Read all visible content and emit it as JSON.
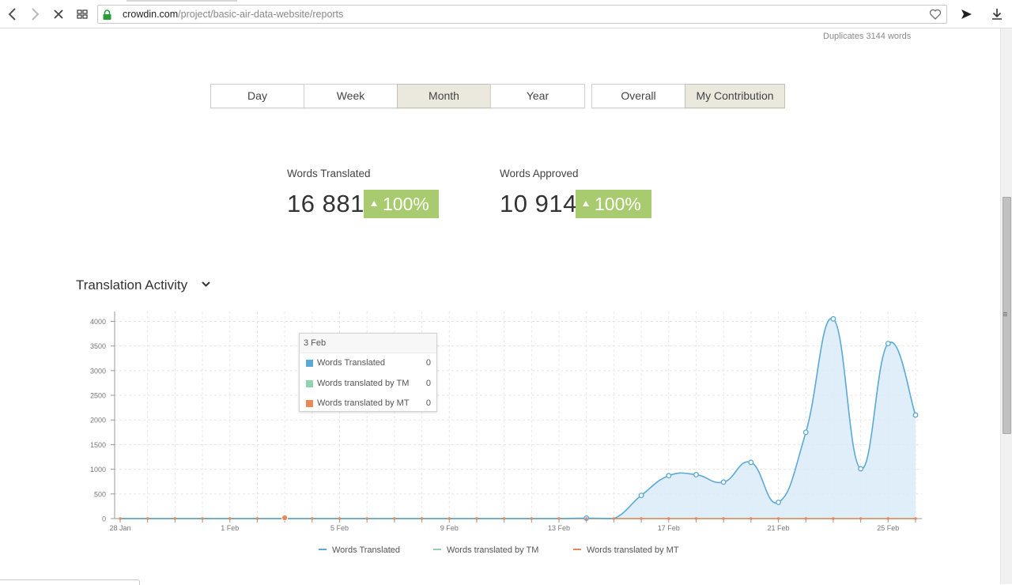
{
  "browser": {
    "url_host": "crowdin.com",
    "url_path": "/project/basic-air-data-website/reports",
    "icons": [
      "back-icon",
      "forward-icon",
      "stop-icon",
      "tabs-grid-icon",
      "lock-icon",
      "heart-icon",
      "send-icon",
      "download-icon"
    ]
  },
  "header": {
    "duplicates": "Duplicates 3144 words"
  },
  "period_buttons": [
    {
      "label": "Day",
      "active": false
    },
    {
      "label": "Week",
      "active": false
    },
    {
      "label": "Month",
      "active": true
    },
    {
      "label": "Year",
      "active": false
    }
  ],
  "scope_buttons": [
    {
      "label": "Overall",
      "active": false
    },
    {
      "label": "My Contribution",
      "active": true
    }
  ],
  "stats": {
    "translated": {
      "label": "Words Translated",
      "value": "16 881",
      "change": "100%"
    },
    "approved": {
      "label": "Words Approved",
      "value": "10 914",
      "change": "100%"
    }
  },
  "section": {
    "title": "Translation Activity"
  },
  "colors": {
    "translated": "#5aa9d6",
    "tm": "#7fd3a6",
    "mt": "#e8895a",
    "badge": "#a7cb6e",
    "area_fill": "#d9ebf8",
    "active_button": "#ebe8de"
  },
  "tooltip": {
    "date": "3 Feb",
    "rows": [
      {
        "name": "Words Translated",
        "value": "0",
        "color": "#5aa9d6"
      },
      {
        "name": "Words translated by TM",
        "value": "0",
        "color": "#7fd3a6"
      },
      {
        "name": "Words translated by MT",
        "value": "0",
        "color": "#e8895a"
      }
    ]
  },
  "chart_data": {
    "type": "area",
    "x": [
      "28 Jan",
      "29 Jan",
      "30 Jan",
      "31 Jan",
      "1 Feb",
      "2 Feb",
      "3 Feb",
      "4 Feb",
      "5 Feb",
      "6 Feb",
      "7 Feb",
      "8 Feb",
      "9 Feb",
      "10 Feb",
      "11 Feb",
      "12 Feb",
      "13 Feb",
      "14 Feb",
      "15 Feb",
      "16 Feb",
      "17 Feb",
      "18 Feb",
      "19 Feb",
      "20 Feb",
      "21 Feb",
      "22 Feb",
      "23 Feb",
      "24 Feb",
      "25 Feb",
      "26 Feb"
    ],
    "x_tick_labels": [
      "28 Jan",
      "1 Feb",
      "5 Feb",
      "9 Feb",
      "13 Feb",
      "17 Feb",
      "21 Feb",
      "25 Feb"
    ],
    "y_ticks": [
      0,
      500,
      1000,
      1500,
      2000,
      2500,
      3000,
      3500,
      4000
    ],
    "ylim": [
      0,
      4200
    ],
    "grid": true,
    "legend_position": "bottom",
    "series": [
      {
        "name": "Words Translated",
        "values": [
          0,
          0,
          0,
          0,
          0,
          0,
          0,
          0,
          0,
          0,
          0,
          0,
          0,
          0,
          0,
          0,
          0,
          10,
          0,
          470,
          870,
          890,
          740,
          1140,
          330,
          1750,
          4050,
          1010,
          3550,
          2100
        ]
      },
      {
        "name": "Words translated by TM",
        "values": [
          0,
          0,
          0,
          0,
          0,
          0,
          0,
          0,
          0,
          0,
          0,
          0,
          0,
          0,
          0,
          0,
          0,
          0,
          0,
          0,
          0,
          0,
          0,
          0,
          0,
          0,
          0,
          0,
          0,
          0
        ]
      },
      {
        "name": "Words translated by MT",
        "values": [
          0,
          0,
          0,
          0,
          0,
          0,
          0,
          0,
          0,
          0,
          0,
          0,
          0,
          0,
          0,
          0,
          0,
          0,
          0,
          0,
          0,
          0,
          0,
          0,
          0,
          0,
          0,
          0,
          0,
          0
        ]
      }
    ],
    "highlighted_index": 6
  }
}
